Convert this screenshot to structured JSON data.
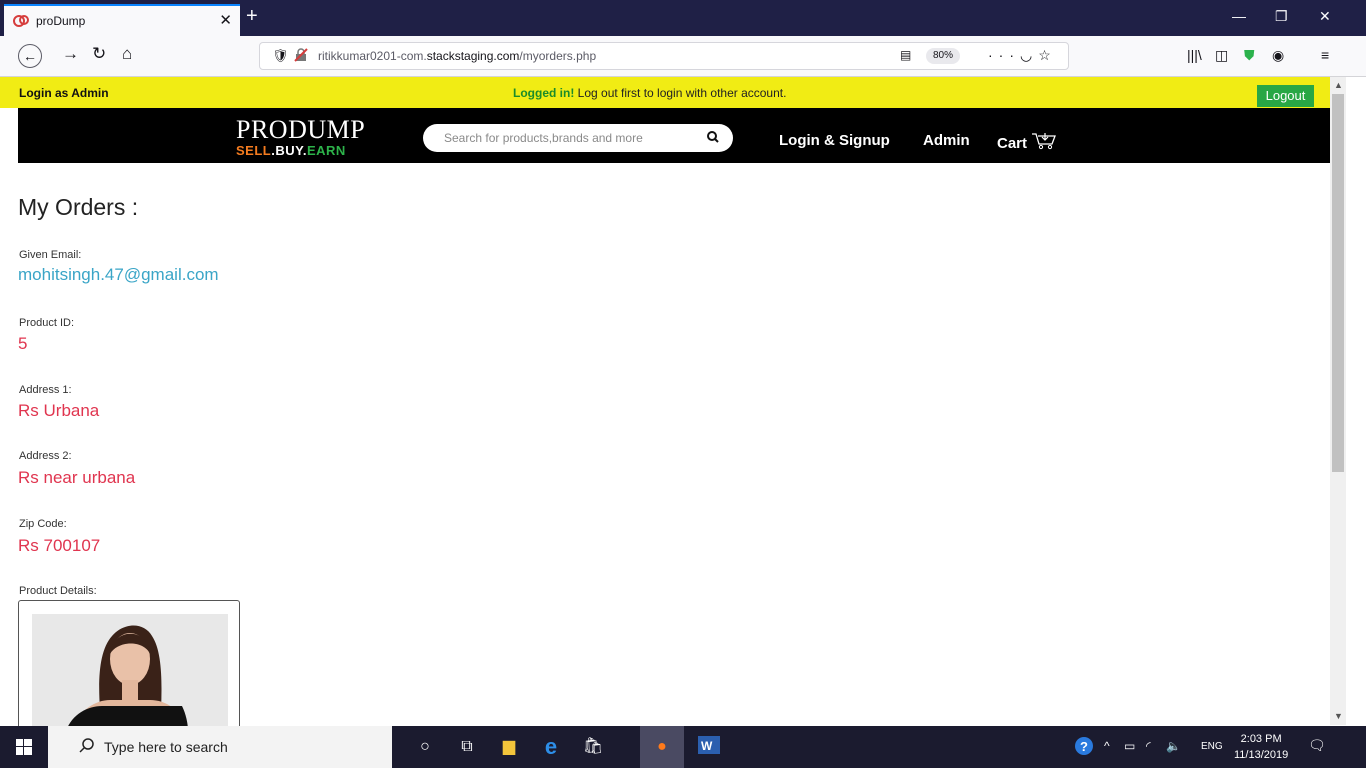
{
  "browser": {
    "tab_title": "proDump",
    "url_prefix": "ritikkumar0201-com.",
    "url_domain": "stackstaging.com",
    "url_path": "/myorders.php",
    "zoom": "80%"
  },
  "adminbar": {
    "left_text": "Login as Admin",
    "logged_in": "Logged in!",
    "message": " Log out first to login with other account.",
    "logout_label": "Logout"
  },
  "header": {
    "logo_main": "PRODUMP",
    "logo_sell": "SELL",
    "logo_buy": ".BUY.",
    "logo_earn": "EARN",
    "search_placeholder": "Search  for products,brands and more",
    "nav": {
      "login": "Login & Signup",
      "admin": "Admin",
      "cart": "Cart"
    }
  },
  "content": {
    "title": "My Orders :",
    "fields": [
      {
        "label": "Given Email:",
        "value": "mohitsingh.47@gmail.com"
      },
      {
        "label": "Product ID:",
        "value": "5"
      },
      {
        "label": "Address 1:",
        "value": "Rs Urbana"
      },
      {
        "label": "Address 2:",
        "value": "Rs near urbana"
      },
      {
        "label": "Zip Code:",
        "value": "Rs 700107"
      }
    ],
    "product_details_label": "Product Details:"
  },
  "taskbar": {
    "search_placeholder": "Type here to search",
    "lang": "ENG",
    "time": "2:03 PM",
    "date": "11/13/2019"
  },
  "colors": {
    "admin_bar": "#f1ec14",
    "logout_green": "#28a745",
    "email_blue": "#3aa5c7",
    "value_red": "#e0354f",
    "logo_sell_orange": "#f57c1f",
    "logo_earn_green": "#2db34a"
  }
}
